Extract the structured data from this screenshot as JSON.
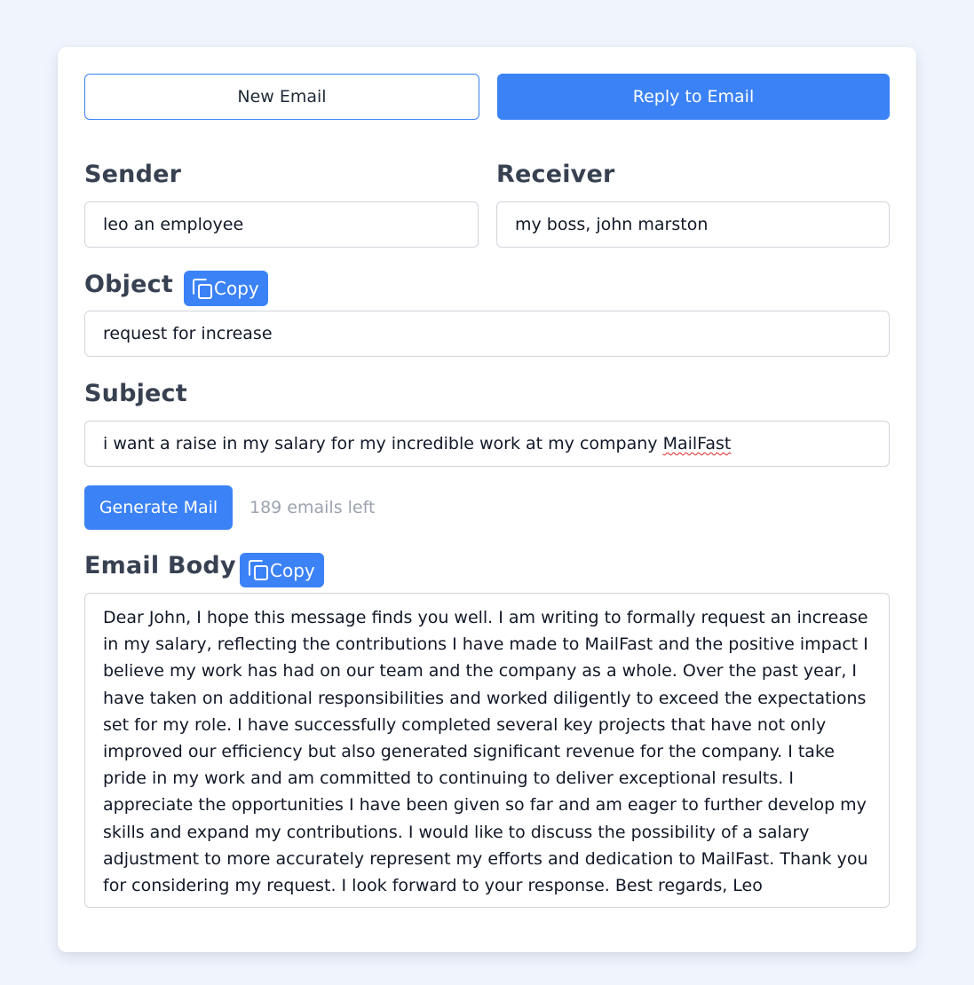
{
  "tabs": {
    "new_email": "New Email",
    "reply_to_email": "Reply to Email"
  },
  "sender": {
    "label": "Sender",
    "value": "leo an employee"
  },
  "receiver": {
    "label": "Receiver",
    "value": "my boss, john marston"
  },
  "object": {
    "label": "Object",
    "copy_label": "Copy",
    "value": "request for increase"
  },
  "subject": {
    "label": "Subject",
    "value_prefix": "i want a raise in my salary for my incredible work at my company ",
    "value_flagged": "MailFast"
  },
  "generate": {
    "button_label": "Generate Mail",
    "remaining": "189 emails left"
  },
  "email_body": {
    "label": "Email Body",
    "copy_label": "Copy",
    "text": "Dear John, I hope this message finds you well. I am writing to formally request an increase in my salary, reflecting the contributions I have made to MailFast and the positive impact I believe my work has had on our team and the company as a whole. Over the past year, I have taken on additional responsibilities and worked diligently to exceed the expectations set for my role. I have successfully completed several key projects that have not only improved our efficiency but also generated significant revenue for the company. I take pride in my work and am committed to continuing to deliver exceptional results. I appreciate the opportunities I have been given so far and am eager to further develop my skills and expand my contributions. I would like to discuss the possibility of a salary adjustment to more accurately represent my efforts and dedication to MailFast. Thank you for considering my request. I look forward to your response. Best regards, Leo"
  },
  "icons": {
    "copy": "copy-icon"
  },
  "colors": {
    "accent": "#3b82f6",
    "page_background": "#eff4fd",
    "muted_text": "#9ca3af"
  }
}
